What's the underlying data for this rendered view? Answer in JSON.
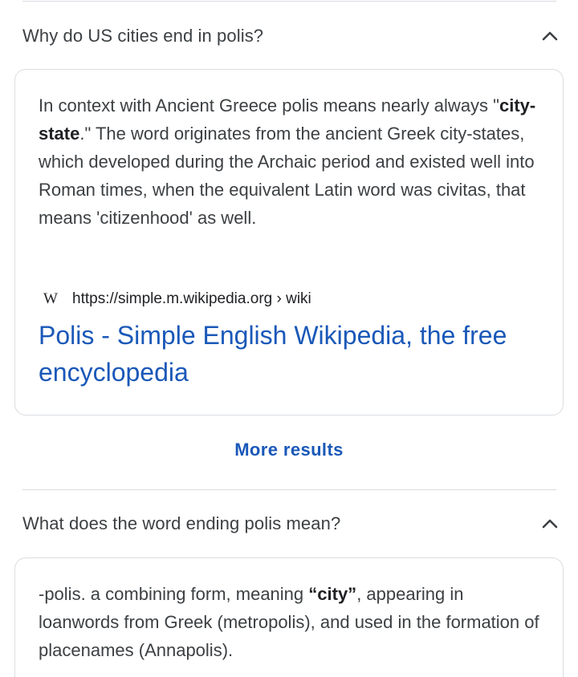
{
  "faq": [
    {
      "question": "Why do US cities end in polis?",
      "expanded": true,
      "answer": {
        "before": "In context with Ancient Greece polis means nearly always \"",
        "bold": "city-state",
        "after": ".\" The word originates from the ancient Greek city-states, which developed during the Archaic period and existed well into Roman times, when the equivalent Latin word was civitas, that means 'citizenhood' as well."
      },
      "source": {
        "icon": "wikipedia-w-icon",
        "logo_text": "W",
        "url": "https://simple.m.wikipedia.org › wiki",
        "title": "Polis - Simple English Wikipedia, the free encyclopedia"
      }
    },
    {
      "question": "What does the word ending polis mean?",
      "expanded": true,
      "answer": {
        "before": "-polis. a combining form, meaning ",
        "bold": "“city”",
        "after": ", appearing in loanwords from Greek (metropolis), and used in the formation of placenames (Annapolis)."
      }
    }
  ],
  "more_results_label": "More results",
  "colors": {
    "link": "#1a58b8",
    "text": "#3c4043",
    "divider": "#dadce0"
  }
}
